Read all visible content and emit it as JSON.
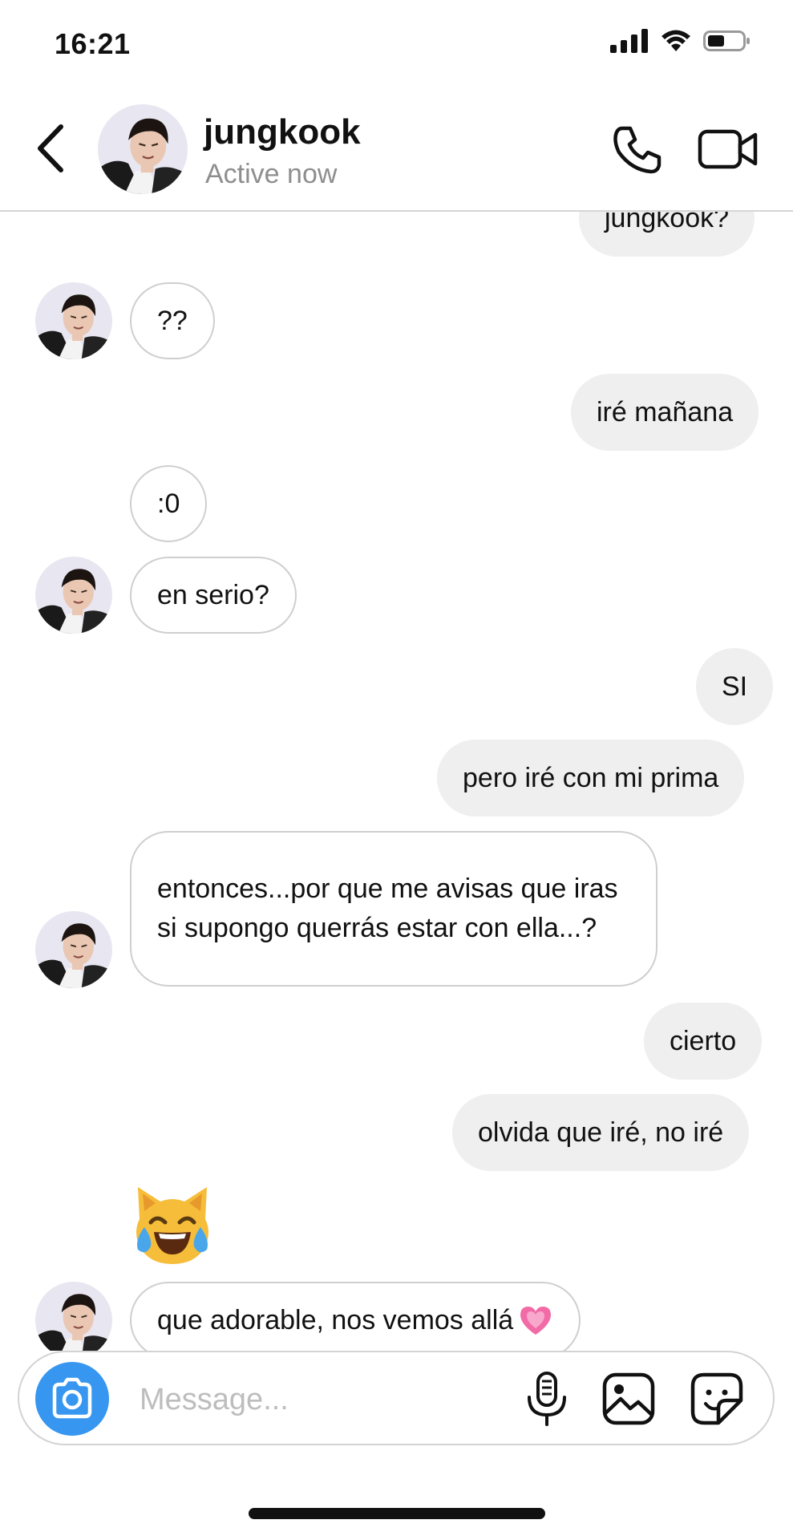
{
  "status_bar": {
    "time": "16:21"
  },
  "header": {
    "contact_name": "jungkook",
    "contact_status": "Active now"
  },
  "messages": [
    {
      "sender": "me",
      "text": "jungkook?"
    },
    {
      "sender": "contact",
      "text": "??"
    },
    {
      "sender": "me",
      "text": "iré mañana"
    },
    {
      "sender": "contact",
      "text": ":0"
    },
    {
      "sender": "contact",
      "text": "en serio?"
    },
    {
      "sender": "me",
      "text": "SI"
    },
    {
      "sender": "me",
      "text": "pero iré con mi prima"
    },
    {
      "sender": "contact",
      "text": "entonces...por que me avisas que iras si supongo querrás estar con ella...?"
    },
    {
      "sender": "me",
      "text": "cierto"
    },
    {
      "sender": "me",
      "text": "olvida que iré, no iré"
    },
    {
      "sender": "contact",
      "emoji": "cat-tears-of-joy"
    },
    {
      "sender": "contact",
      "text": "que adorable, nos vemos allá",
      "emoji": "growing-heart"
    }
  ],
  "composer": {
    "placeholder": "Message..."
  },
  "colors": {
    "accent": "#3797f0",
    "outgoing_bubble": "#efefef",
    "incoming_border": "#cfcfcf",
    "secondary_text": "#8e8e8e"
  },
  "icons": {
    "back": "chevron-left-icon",
    "call": "phone-icon",
    "video": "video-camera-icon",
    "camera": "camera-icon",
    "mic": "microphone-icon",
    "gallery": "image-icon",
    "sticker": "sticker-icon"
  }
}
